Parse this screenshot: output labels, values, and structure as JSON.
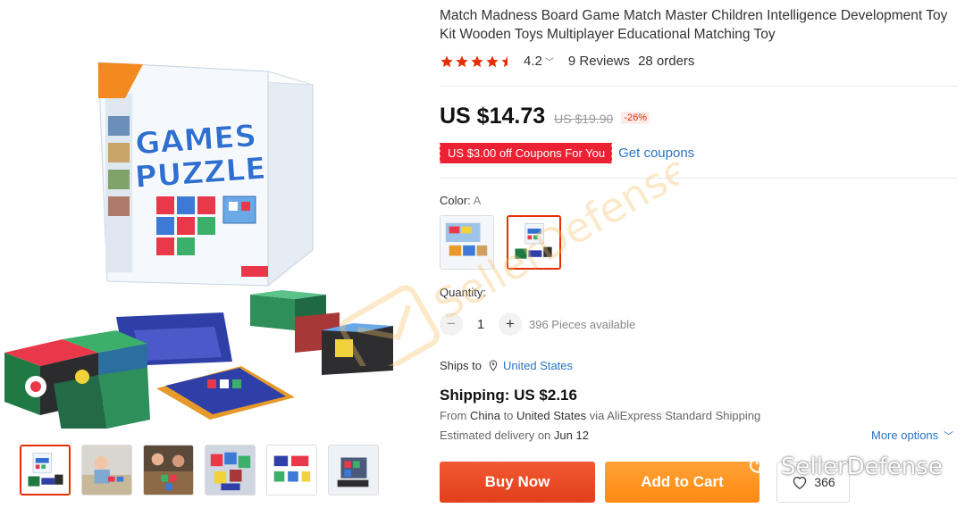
{
  "product": {
    "title": "Match Madness Board Game Match Master Children Intelligence Development Toy Kit Wooden Toys Multiplayer Educational Matching Toy",
    "image_box_text": "GAMES PUZZLE",
    "thumbnails": [
      "thumb-1",
      "thumb-2",
      "thumb-3",
      "thumb-4",
      "thumb-5",
      "thumb-6"
    ]
  },
  "rating": {
    "stars": 4.2,
    "value": "4.2",
    "reviews": "9 Reviews",
    "orders": "28 orders"
  },
  "price": {
    "current": "US $14.73",
    "original": "US $19.90",
    "discount": "-26%"
  },
  "coupon": {
    "label": "US $3.00 off Coupons For You",
    "link": "Get coupons"
  },
  "color": {
    "label": "Color: ",
    "value": "A",
    "options": [
      "option-1",
      "option-2"
    ],
    "selected_index": 1
  },
  "quantity": {
    "label": "Quantity:",
    "minus": "−",
    "value": "1",
    "plus": "+",
    "available": "396 Pieces available"
  },
  "shipping": {
    "ships_to_label": "Ships to",
    "country": "United States",
    "price": "Shipping: US $2.16",
    "from_prefix": "From",
    "from": "China",
    "to_word": "to",
    "to": "United States",
    "via": "via AliExpress Standard Shipping",
    "estimated_label": "Estimated delivery on",
    "estimated_date": "Jun 12",
    "more_options": "More options"
  },
  "actions": {
    "buy_now": "Buy Now",
    "add_to_cart": "Add to Cart",
    "wishlist_count": "366"
  },
  "watermark": {
    "text": "SellerDefense"
  },
  "colors": {
    "accent_red": "#e62e04",
    "coupon_red": "#ec2133",
    "link_blue": "#2a74c4",
    "buy_orange_red": "#e23e1c",
    "cart_orange": "#ff8a12",
    "star": "#e62e04"
  }
}
